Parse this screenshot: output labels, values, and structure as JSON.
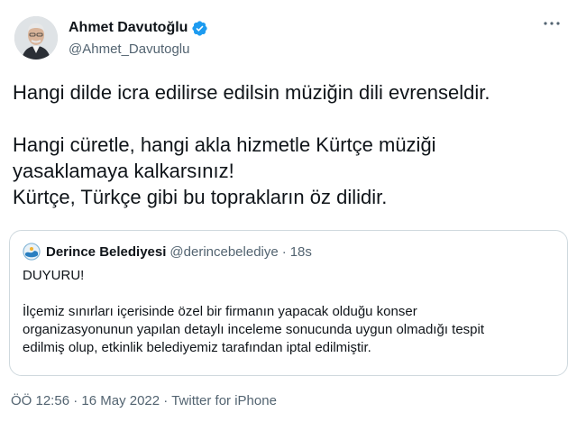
{
  "colors": {
    "text": "#0f1419",
    "secondary": "#536471",
    "verified": "#1d9bf0",
    "border": "#cfd9de"
  },
  "author": {
    "display_name": "Ahmet Davutoğlu",
    "handle": "@Ahmet_Davutoglu",
    "verified_icon": "verified-badge-icon",
    "avatar_icon": "profile-photo"
  },
  "more_icon": "more-dots-icon",
  "tweet": {
    "line1": "Hangi dilde icra edilirse edilsin müziğin dili evrenseldir.",
    "line2": "Hangi cüretle, hangi akla hizmetle Kürtçe müziği",
    "line3": "yasaklamaya kalkarsınız!",
    "line4": "Kürtçe, Türkçe gibi bu toprakların öz dilidir."
  },
  "quote": {
    "name": "Derince Belediyesi",
    "handle": "@derincebelediye",
    "separator": "·",
    "time": "18s",
    "avatar_icon": "municipality-logo",
    "body_line1": "DUYURU!",
    "body_line2": "İlçemiz sınırları içerisinde özel bir firmanın yapacak olduğu konser",
    "body_line3": "organizasyonunun yapılan detaylı inceleme sonucunda uygun olmadığı tespit",
    "body_line4": "edilmiş olup, etkinlik belediyemiz tarafından iptal edilmiştir."
  },
  "meta": {
    "time": "ÖÖ 12:56",
    "separator1": "·",
    "date": "16 May 2022",
    "separator2": "·",
    "source": "Twitter for iPhone"
  }
}
